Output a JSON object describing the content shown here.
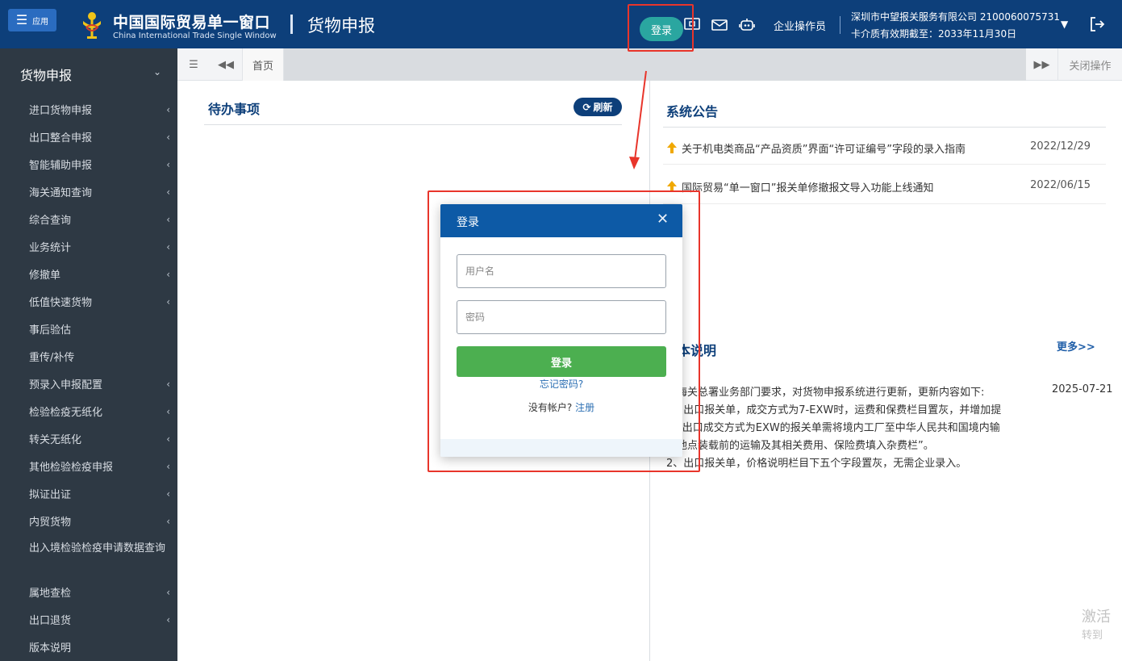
{
  "header": {
    "app_label": "应用",
    "logo_cn": "中国国际贸易单一窗口",
    "logo_en": "China International Trade Single Window",
    "title": "货物申报",
    "login_label": "登录",
    "role": "企业操作员",
    "company": "深圳市中望报关服务有限公司 2100060075731",
    "validity": "卡介质有效期截至：2033年11月30日",
    "icons": [
      "monitor-icon",
      "mail-icon",
      "robot-icon",
      "chevron-down-icon",
      "logout-icon"
    ]
  },
  "sidebar": {
    "title": "货物申报",
    "items": [
      {
        "label": "进口货物申报",
        "chevron": true
      },
      {
        "label": "出口整合申报",
        "chevron": true
      },
      {
        "label": "智能辅助申报",
        "chevron": true
      },
      {
        "label": "海关通知查询",
        "chevron": true
      },
      {
        "label": "综合查询",
        "chevron": true
      },
      {
        "label": "业务统计",
        "chevron": true
      },
      {
        "label": "修撤单",
        "chevron": true
      },
      {
        "label": "低值快速货物",
        "chevron": true
      },
      {
        "label": "事后验估",
        "chevron": false
      },
      {
        "label": "重传/补传",
        "chevron": false
      },
      {
        "label": "预录入申报配置",
        "chevron": true
      },
      {
        "label": "检验检疫无纸化",
        "chevron": true
      },
      {
        "label": "转关无纸化",
        "chevron": true
      },
      {
        "label": "其他检验检疫申报",
        "chevron": true
      },
      {
        "label": "拟证出证",
        "chevron": true
      },
      {
        "label": "内贸货物",
        "chevron": true
      },
      {
        "label": "出入境检验检疫申请数据查询",
        "chevron": false
      },
      {
        "label": "属地查检",
        "chevron": true
      },
      {
        "label": "出口退货",
        "chevron": true
      },
      {
        "label": "版本说明",
        "chevron": false
      }
    ]
  },
  "tabs": {
    "home": "首页",
    "close_ops": "关闭操作"
  },
  "todo": {
    "title": "待办事项",
    "refresh": "刷新"
  },
  "notices": {
    "title": "系统公告",
    "items": [
      {
        "text": "关于机电类商品“产品资质”界面“许可证编号”字段的录入指南",
        "date": "2022/12/29"
      },
      {
        "text": "国际贸易“单一窗口”报关单修撤报文导入功能上线通知",
        "date": "2022/06/15"
      }
    ]
  },
  "version": {
    "title": "本说明",
    "more": "更多>>",
    "date": "2025-07-21",
    "lines": [
      "据海关总署业务部门要求，对货物申报系统进行更新，更新内容如下:",
      "1、出口报关单，成交方式为7-EXW时，运费和保费栏目置灰，并增加提",
      "示“出口成交方式为EXW的报关单需将境内工厂至中华人民共和国境内输",
      "出地点装载前的运输及其相关费用、保险费填入杂费栏”。",
      "2、出口报关单，价格说明栏目下五个字段置灰，无需企业录入。"
    ]
  },
  "watermark": {
    "line1": "激活",
    "line2": "转到"
  },
  "modal": {
    "title": "登录",
    "username_placeholder": "用户名",
    "password_placeholder": "密码",
    "login_button": "登录",
    "forgot": "忘记密码?",
    "no_account": "没有帐户?",
    "register": "注册"
  },
  "colors": {
    "header_bg": "#0d3f7a",
    "sidebar_bg": "#2e3944",
    "login_pill": "#2aa6a0",
    "modal_header": "#0d5aa6",
    "login_button": "#4caf50",
    "highlight": "#e8352b"
  }
}
